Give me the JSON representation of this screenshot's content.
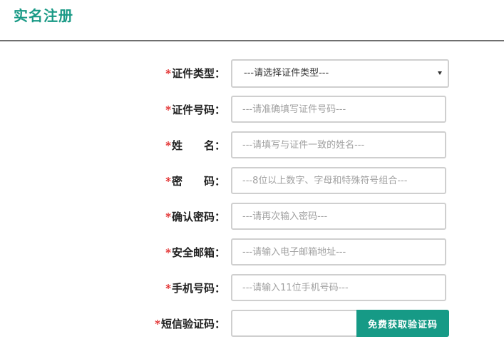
{
  "header": {
    "title": "实名注册"
  },
  "colors": {
    "accent": "#169a86",
    "required": "#e02020",
    "border": "#cfcfcf"
  },
  "form": {
    "required_mark": "*",
    "id_type": {
      "label": "证件类型：",
      "selected": "---请选择证件类型---"
    },
    "id_number": {
      "label": "证件号码：",
      "placeholder": "---请准确填写证件号码---"
    },
    "name": {
      "label": "姓　　名：",
      "placeholder": "---请填写与证件一致的姓名---"
    },
    "password": {
      "label": "密　　码：",
      "placeholder": "---8位以上数字、字母和特殊符号组合---"
    },
    "confirm_password": {
      "label": "确认密码：",
      "placeholder": "---请再次输入密码---"
    },
    "email": {
      "label": "安全邮箱：",
      "placeholder": "---请输入电子邮箱地址---"
    },
    "phone": {
      "label": "手机号码：",
      "placeholder": "---请输入11位手机号码---"
    },
    "sms_code": {
      "label": "短信验证码：",
      "value": "",
      "button_label": "免费获取验证码"
    }
  }
}
